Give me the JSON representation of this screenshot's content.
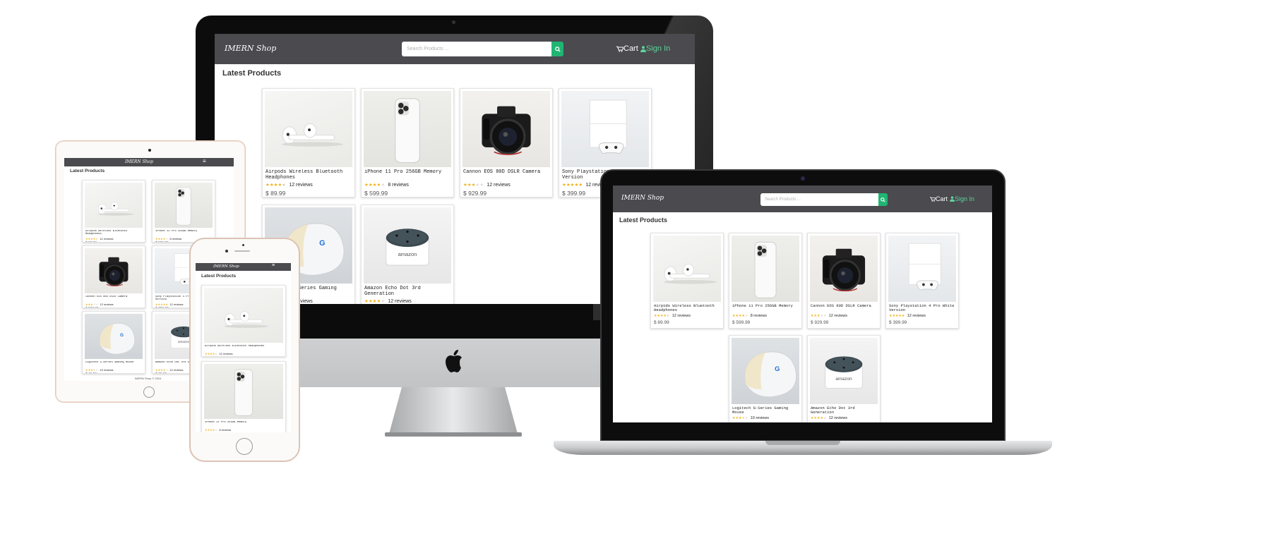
{
  "shop": {
    "logo": "IMERN Shop",
    "search_placeholder": "Search Products ...",
    "cart_label": "Cart",
    "signin_label": "Sign In",
    "section_title": "Latest Products",
    "footer": "IMERN Shop © 2024"
  },
  "products": [
    {
      "name": "Airpods Wireless Bluetooth Headphones",
      "stars": 4.5,
      "reviews": "12 reviews",
      "price": "$ 89.99",
      "image": "airpods"
    },
    {
      "name": "iPhone 11 Pro 256GB Memory",
      "stars": 4,
      "reviews": "8 reviews",
      "price": "$ 599.99",
      "image": "iphone"
    },
    {
      "name": "Cannon EOS 80D DSLR Camera",
      "stars": 3,
      "reviews": "12 reviews",
      "price": "$ 929.99",
      "image": "camera"
    },
    {
      "name": "Sony Playstation 4 Pro White Version",
      "stars": 5,
      "reviews": "12 reviews",
      "price": "$ 399.99",
      "image": "playstation"
    },
    {
      "name": "Logitech G-Series Gaming Mouse",
      "stars": 3.5,
      "reviews": "10 reviews",
      "price": "$ 49.99",
      "image": "mouse"
    },
    {
      "name": "Amazon Echo Dot 3rd Generation",
      "stars": 4,
      "reviews": "12 reviews",
      "price": "$ 29.99",
      "image": "echo"
    }
  ],
  "icons": {
    "search": "search-icon",
    "cart": "cart-icon",
    "user": "user-icon",
    "menu": "hamburger-menu-icon",
    "apple": "apple-logo-icon"
  },
  "colors": {
    "navbar": "#4a4a4f",
    "accent": "#21b573",
    "signin": "#5fd39a",
    "star": "#f2b21b",
    "bezel": "#111111"
  }
}
